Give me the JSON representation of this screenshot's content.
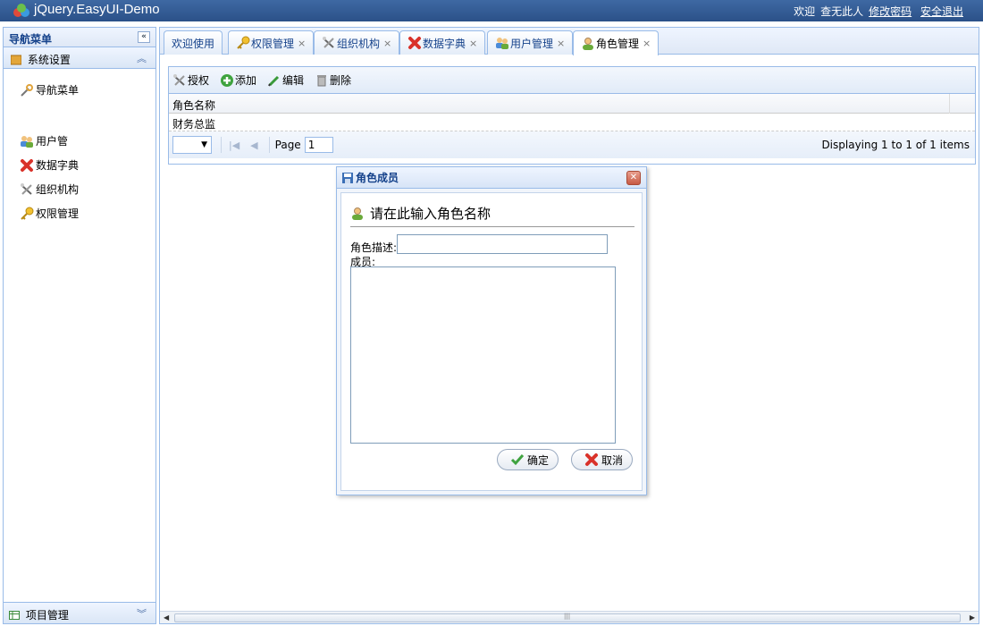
{
  "app": {
    "title": "jQuery.EasyUI-Demo",
    "welcome": "欢迎",
    "username": "查无此人",
    "change_password": "修改密码",
    "logout": "安全退出"
  },
  "sidebar": {
    "title": "导航菜单",
    "collapse_symbol": "«",
    "section": {
      "label": "系统设置",
      "expand_symbol": "︽"
    },
    "items": [
      {
        "label": "导航菜单",
        "icon": "wrench-icon"
      },
      {
        "label": "用户管",
        "icon": "users-icon"
      },
      {
        "label": "数据字典",
        "icon": "red-x-icon"
      },
      {
        "label": "组织机构",
        "icon": "tools-icon"
      },
      {
        "label": "权限管理",
        "icon": "key-icon"
      }
    ],
    "bottom_section": {
      "label": "项目管理",
      "expand_symbol": "︾"
    }
  },
  "tabs": [
    {
      "label": "欢迎使用",
      "icon": "",
      "closable": false
    },
    {
      "label": "权限管理",
      "icon": "key-icon",
      "closable": true
    },
    {
      "label": "组织机构",
      "icon": "tools-icon",
      "closable": true
    },
    {
      "label": "数据字典",
      "icon": "red-x-icon",
      "closable": true
    },
    {
      "label": "用户管理",
      "icon": "users-icon",
      "closable": true
    },
    {
      "label": "角色管理",
      "icon": "user-icon",
      "closable": true,
      "active": true
    }
  ],
  "close_symbol": "×",
  "toolbar": {
    "authorize": "授权",
    "add": "添加",
    "edit": "编辑",
    "delete": "删除"
  },
  "grid": {
    "column": "角色名称",
    "rows": [
      "财务总监"
    ]
  },
  "pager": {
    "page_label": "Page",
    "page_value": "1",
    "info": "Displaying 1 to 1 of 1 items"
  },
  "dialog": {
    "title": "角色成员",
    "heading": "请在此输入角色名称",
    "desc_label": "角色描述:",
    "desc_value": "",
    "members_label": "成员:",
    "members_value": "",
    "ok": "确定",
    "cancel": "取消"
  },
  "colors": {
    "header": "#2b5188",
    "border": "#99bbe8",
    "accent_text": "#15428b"
  }
}
